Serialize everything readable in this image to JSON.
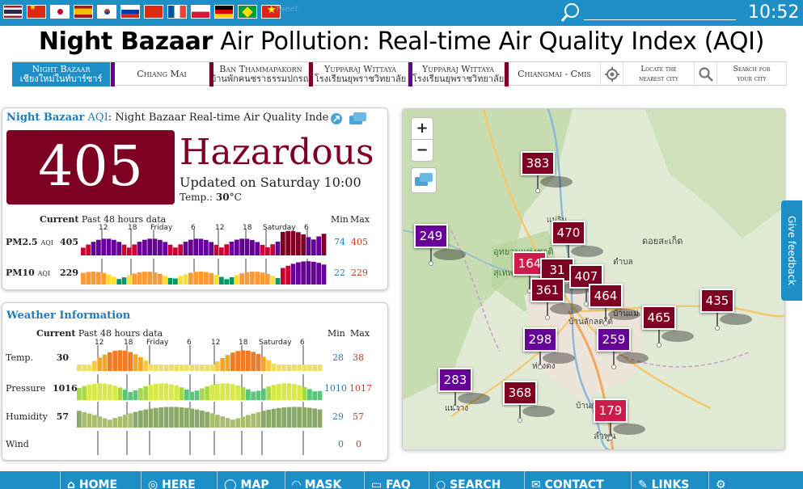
{
  "header": {
    "flags": [
      "thai",
      "cn",
      "jp",
      "es",
      "kr",
      "ru",
      "hk",
      "fr",
      "pl",
      "de",
      "br",
      "vn"
    ],
    "tweet_label": "Tweet",
    "search_value": "",
    "time": "10:52",
    "color": "#1e8fc6"
  },
  "title": {
    "bold": "Night Bazaar",
    "rest": " Air Pollution: Real-time Air Quality Index (AQI)"
  },
  "city_tabs": [
    {
      "line1": "Night Bazaar",
      "line2": "เชียงใหม่ในท์บาร์ซาร์",
      "active": true
    },
    {
      "line1": "Chiang Mai",
      "line2": ""
    },
    {
      "line1": "Ban Thammapakorn",
      "line2": "บ้านพักคนชราธรรมปกรณ์"
    },
    {
      "line1": "Yupparaj Wittaya",
      "line2": "โรงเรียนยุพราชวิทยาลัย"
    },
    {
      "line1": "Yupparaj Wittaya",
      "line2": "โรงเรียนยุพราชวิทยาลัย"
    },
    {
      "line1": "Chiangmai - Cmis",
      "line2": ""
    },
    {
      "line1": "Locate the",
      "line2": "nearest city"
    },
    {
      "line1": "Search for",
      "line2": "your city"
    }
  ],
  "aqi": {
    "heading_name": "Night Bazaar",
    "heading_aqi": "AQI",
    "heading_rest": ": Night Bazaar Real-time Air Quality Inde",
    "value": "405",
    "status": "Hazardous",
    "updated": "Updated on Saturday 10:00",
    "temp_label": "Temp.:",
    "temp_value": "30",
    "temp_unit": "°C",
    "current_label": "Current",
    "past_label": "Past 48 hours data",
    "min_label": "Min",
    "max_label": "Max",
    "ticks": [
      "12",
      "18",
      "Friday",
      "6",
      "12",
      "18",
      "Saturday",
      "6"
    ],
    "rows": [
      {
        "label": "PM2.5",
        "unit": "AQI",
        "current": "405",
        "min": "74",
        "max": "405"
      },
      {
        "label": "PM10",
        "unit": "AQI",
        "current": "229",
        "min": "22",
        "max": "229"
      }
    ],
    "color": "#7e0023"
  },
  "weather": {
    "heading": "Weather Information",
    "current_label": "Current",
    "past_label": "Past 48 hours data",
    "min_label": "Min",
    "max_label": "Max",
    "ticks": [
      "12",
      "18",
      "Friday",
      "6",
      "12",
      "18",
      "Saturday",
      "6"
    ],
    "rows": [
      {
        "label": "Temp.",
        "current": "30",
        "min": "28",
        "max": "38"
      },
      {
        "label": "Pressure",
        "current": "1016",
        "min": "1010",
        "max": "1017"
      },
      {
        "label": "Humidity",
        "current": "57",
        "min": "29",
        "max": "57"
      },
      {
        "label": "Wind",
        "current": "",
        "min": "0",
        "max": "0"
      }
    ]
  },
  "map": {
    "zoom_in": "+",
    "zoom_out": "−",
    "labels": [
      "แม่ริม",
      "ดอยสะเก็ด",
      "อุทยานแห่งชาติ",
      "สุเทพ",
      "บ้านแม่",
      "ห่างดง",
      "แม่วาง",
      "บ้านกลางหลวง",
      "ลำพูน",
      "ตำบล",
      "บ้านลักลดใต้"
    ],
    "markers": [
      {
        "value": "383",
        "color": "#7e0023"
      },
      {
        "value": "249",
        "color": "#660099"
      },
      {
        "value": "470",
        "color": "#7e0023"
      },
      {
        "value": "164",
        "color": "#ce1c4a"
      },
      {
        "value": "31",
        "color": "#7e0023"
      },
      {
        "value": "407",
        "color": "#7e0023"
      },
      {
        "value": "361",
        "color": "#7e0023"
      },
      {
        "value": "464",
        "color": "#7e0023"
      },
      {
        "value": "435",
        "color": "#7e0023"
      },
      {
        "value": "465",
        "color": "#7e0023"
      },
      {
        "value": "298",
        "color": "#660099"
      },
      {
        "value": "259",
        "color": "#660099"
      },
      {
        "value": "283",
        "color": "#660099"
      },
      {
        "value": "368",
        "color": "#7e0023"
      },
      {
        "value": "179",
        "color": "#ce1c4a"
      }
    ]
  },
  "feedback_label": "Give feedback",
  "bottom_nav": [
    "HOME",
    "HERE",
    "MAP",
    "MASK",
    "FAQ",
    "SEARCH",
    "CONTACT",
    "LINKS",
    ""
  ]
}
